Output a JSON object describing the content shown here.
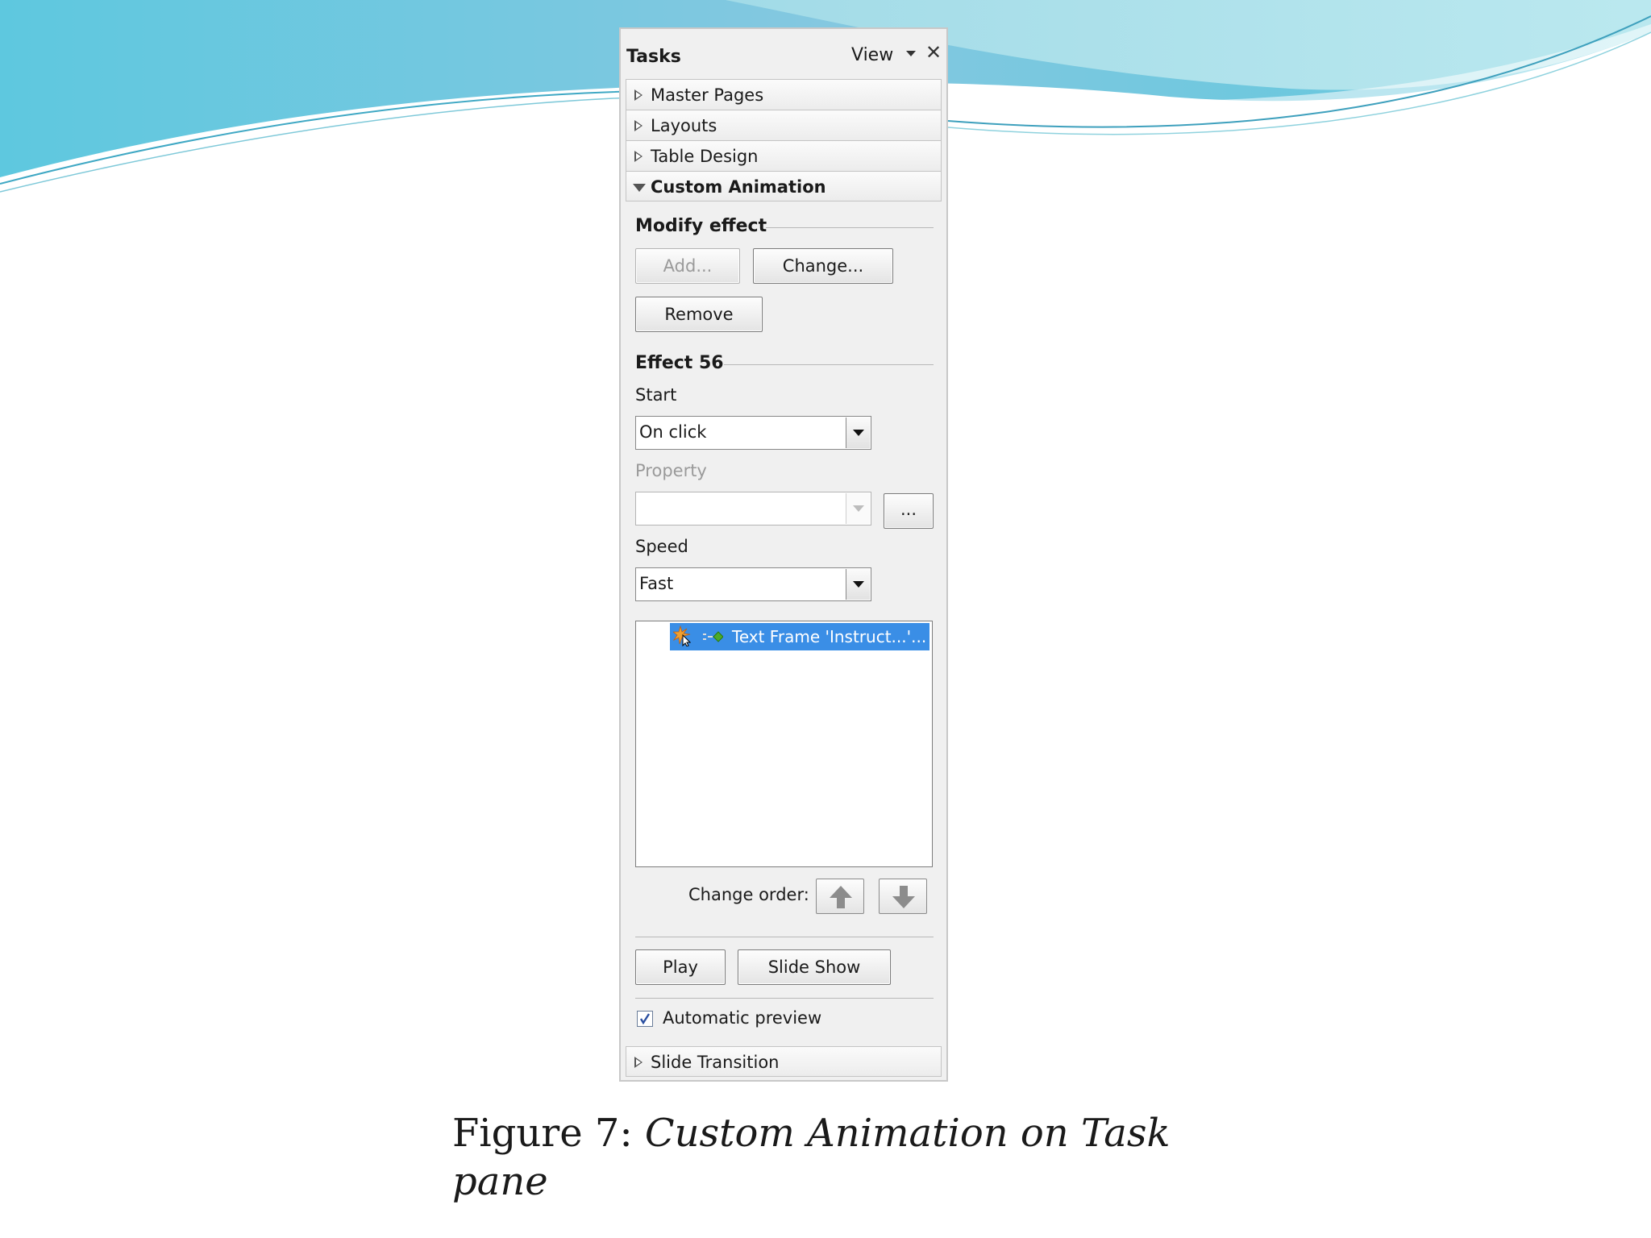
{
  "pane": {
    "title": "Tasks",
    "view_label": "View",
    "close_icon": "close-icon",
    "sections": [
      {
        "label": "Master Pages",
        "expanded": false
      },
      {
        "label": "Layouts",
        "expanded": false
      },
      {
        "label": "Table Design",
        "expanded": false
      },
      {
        "label": "Custom Animation",
        "expanded": true
      }
    ],
    "modify_effect": {
      "title": "Modify effect",
      "add_label": "Add...",
      "change_label": "Change...",
      "remove_label": "Remove"
    },
    "effect": {
      "title": "Effect 56",
      "start_label": "Start",
      "start_value": "On click",
      "property_label": "Property",
      "property_value": "",
      "property_more": "...",
      "speed_label": "Speed",
      "speed_value": "Fast"
    },
    "effect_list": [
      {
        "label": "Text Frame 'Instruct...'...",
        "selected": true
      }
    ],
    "change_order_label": "Change order:",
    "play_label": "Play",
    "slide_show_label": "Slide Show",
    "automatic_preview_label": "Automatic preview",
    "automatic_preview_checked": true,
    "slide_transition_label": "Slide Transition",
    "colors": {
      "selection": "#3a8ee6",
      "pane_bg": "#f0f0f0"
    }
  },
  "caption": {
    "prefix": "Figure 7: ",
    "italic": "Custom Animation on Task pane"
  }
}
